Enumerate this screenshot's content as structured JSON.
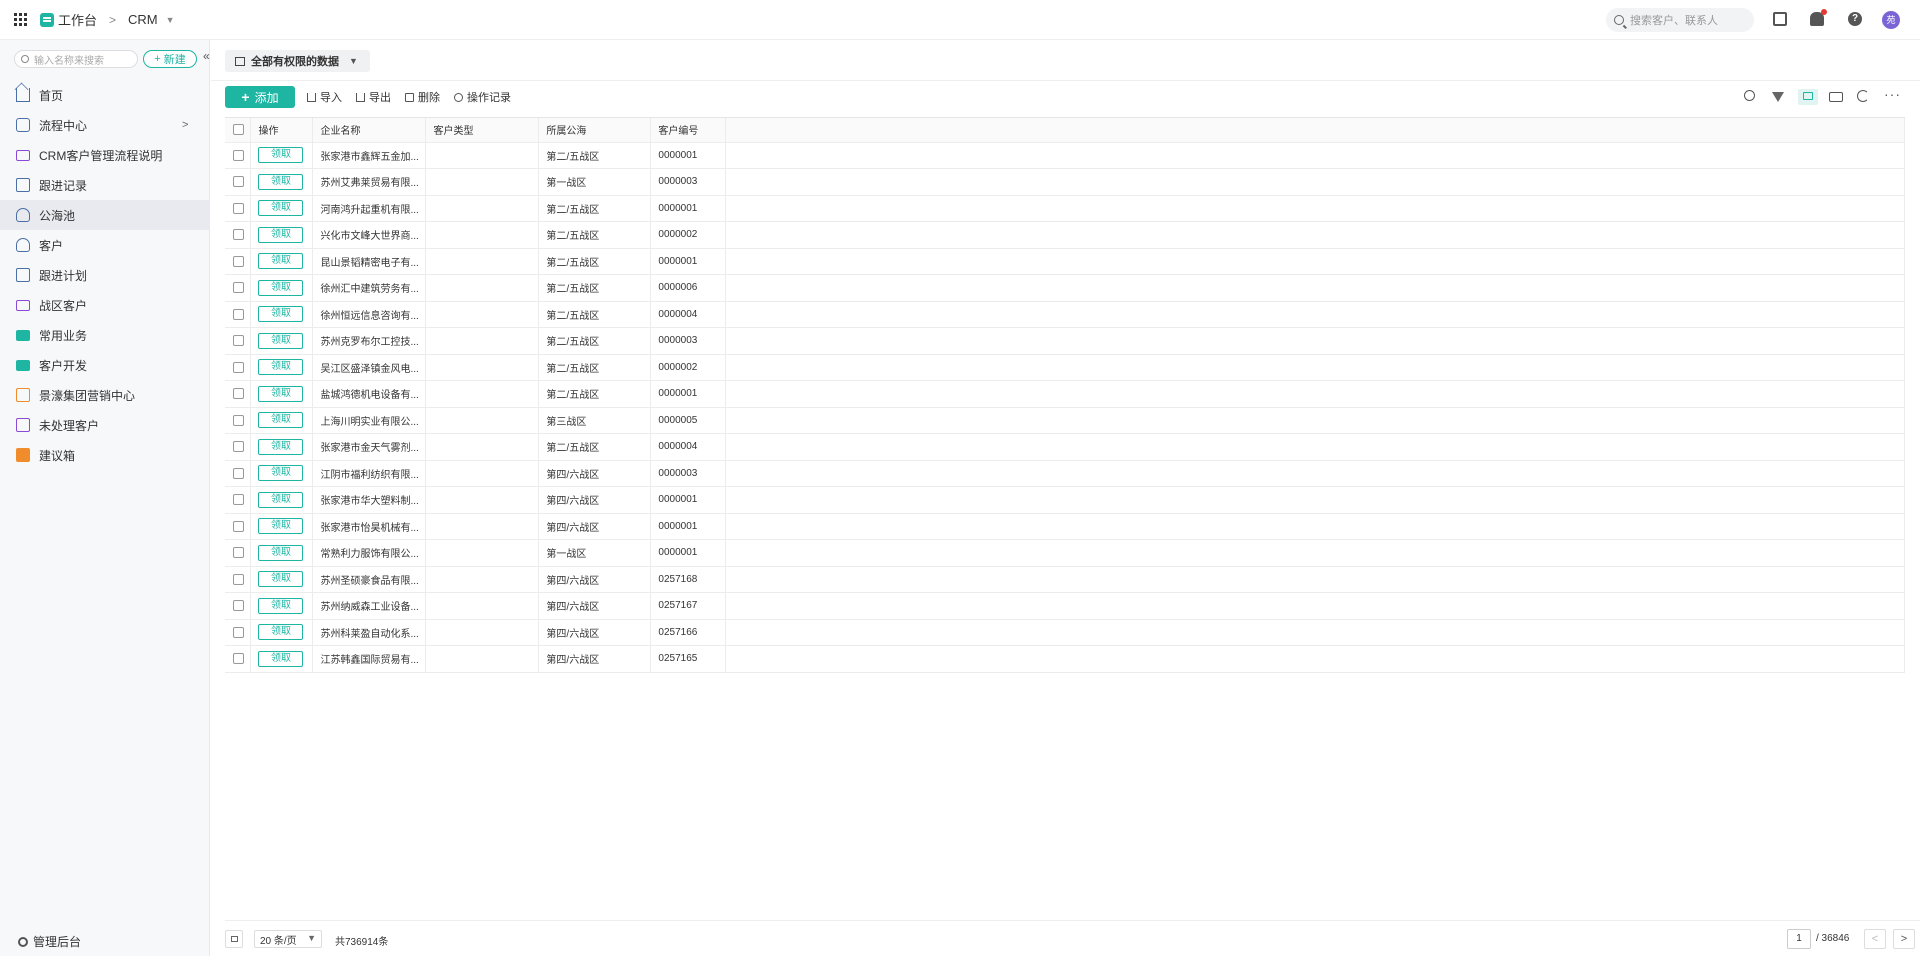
{
  "topbar": {
    "workspace_label": "工作台",
    "app_label": "CRM",
    "search_placeholder": "搜索客户、联系人",
    "avatar_text": "苑"
  },
  "sidebar": {
    "search_placeholder": "输入名称来搜索",
    "new_label": "新建",
    "items": [
      {
        "label": "首页",
        "icon": "home-icon"
      },
      {
        "label": "流程中心",
        "icon": "flow-icon"
      },
      {
        "label": "CRM客户管理流程说明",
        "icon": "screen-icon"
      },
      {
        "label": "跟进记录",
        "icon": "doc-icon"
      },
      {
        "label": "公海池",
        "icon": "user-icon",
        "active": true
      },
      {
        "label": "客户",
        "icon": "user-icon"
      },
      {
        "label": "跟进计划",
        "icon": "calendar-icon"
      },
      {
        "label": "战区客户",
        "icon": "screen-icon"
      },
      {
        "label": "常用业务",
        "icon": "folder-icon"
      },
      {
        "label": "客户开发",
        "icon": "folder-icon"
      },
      {
        "label": "景濠集团营销中心",
        "icon": "doc-icon"
      },
      {
        "label": "未处理客户",
        "icon": "doc-icon"
      },
      {
        "label": "建议箱",
        "icon": "box-icon"
      }
    ],
    "footer_label": "管理后台"
  },
  "view": {
    "label": "全部有权限的数据"
  },
  "toolbar": {
    "add_label": "添加",
    "import_label": "导入",
    "export_label": "导出",
    "delete_label": "删除",
    "log_label": "操作记录"
  },
  "table": {
    "headers": [
      "操作",
      "企业名称",
      "客户类型",
      "所属公海",
      "客户编号"
    ],
    "claim_label": "领取",
    "rows": [
      {
        "name": "张家港市鑫辉五金加...",
        "type": "",
        "sea": "第二/五战区",
        "no": "0000001"
      },
      {
        "name": "苏州艾弗莱贸易有限...",
        "type": "",
        "sea": "第一战区",
        "no": "0000003"
      },
      {
        "name": "河南鸿升起重机有限...",
        "type": "",
        "sea": "第二/五战区",
        "no": "0000001"
      },
      {
        "name": "兴化市文峰大世界商...",
        "type": "",
        "sea": "第二/五战区",
        "no": "0000002"
      },
      {
        "name": "昆山景韬精密电子有...",
        "type": "",
        "sea": "第二/五战区",
        "no": "0000001"
      },
      {
        "name": "徐州汇中建筑劳务有...",
        "type": "",
        "sea": "第二/五战区",
        "no": "0000006"
      },
      {
        "name": "徐州恒远信息咨询有...",
        "type": "",
        "sea": "第二/五战区",
        "no": "0000004"
      },
      {
        "name": "苏州克罗布尔工控技...",
        "type": "",
        "sea": "第二/五战区",
        "no": "0000003"
      },
      {
        "name": "吴江区盛泽镇金风电...",
        "type": "",
        "sea": "第二/五战区",
        "no": "0000002"
      },
      {
        "name": "盐城鸿德机电设备有...",
        "type": "",
        "sea": "第二/五战区",
        "no": "0000001"
      },
      {
        "name": "上海川明实业有限公...",
        "type": "",
        "sea": "第三战区",
        "no": "0000005"
      },
      {
        "name": "张家港市金天气雾剂...",
        "type": "",
        "sea": "第二/五战区",
        "no": "0000004"
      },
      {
        "name": "江阴市福利纺织有限...",
        "type": "",
        "sea": "第四/六战区",
        "no": "0000003"
      },
      {
        "name": "张家港市华大塑料制...",
        "type": "",
        "sea": "第四/六战区",
        "no": "0000001"
      },
      {
        "name": "张家港市怡昊机械有...",
        "type": "",
        "sea": "第四/六战区",
        "no": "0000001"
      },
      {
        "name": "常熟利力服饰有限公...",
        "type": "",
        "sea": "第一战区",
        "no": "0000001"
      },
      {
        "name": "苏州圣硕豪食品有限...",
        "type": "",
        "sea": "第四/六战区",
        "no": "0257168"
      },
      {
        "name": "苏州纳威森工业设备...",
        "type": "",
        "sea": "第四/六战区",
        "no": "0257167"
      },
      {
        "name": "苏州科莱盈自动化系...",
        "type": "",
        "sea": "第四/六战区",
        "no": "0257166"
      },
      {
        "name": "江苏韩鑫国际贸易有...",
        "type": "",
        "sea": "第四/六战区",
        "no": "0257165"
      }
    ]
  },
  "pagination": {
    "page_size": "20 条/页",
    "total": "共736914条",
    "current_page": "1",
    "total_pages": "/ 36846"
  },
  "colors": {
    "accent": "#1fb5a3"
  }
}
